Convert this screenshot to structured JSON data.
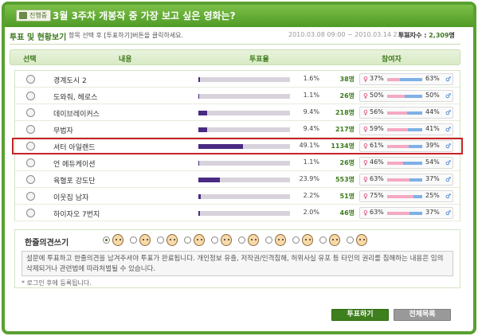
{
  "header": {
    "badge": "진행중",
    "title": "3월 3주차 개봉작 중 가장 보고 싶은 영화는?"
  },
  "subbar": {
    "title": "투표 및 현황보기",
    "desc": "항목 선택 후 [투표하기]버튼을 클릭하세요.",
    "period": "2010.03.08 09:00 ~ 2010.03.14 23:59",
    "total_label": "투표자수 :",
    "total_value": "2,309",
    "total_unit": "명"
  },
  "columns": {
    "select": "선택",
    "content": "내용",
    "rate": "투표율",
    "participants": "참여자"
  },
  "rows": [
    {
      "title": "경계도시 2",
      "pct": "1.6%",
      "pct_value": 1.6,
      "count": "38명",
      "female": "37%",
      "male": "63%",
      "female_value": 37
    },
    {
      "title": "도와줘, 헤로스",
      "pct": "1.1%",
      "pct_value": 1.1,
      "count": "26명",
      "female": "50%",
      "male": "50%",
      "female_value": 50
    },
    {
      "title": "데이브레이커스",
      "pct": "9.4%",
      "pct_value": 9.4,
      "count": "218명",
      "female": "56%",
      "male": "44%",
      "female_value": 56
    },
    {
      "title": "무법자",
      "pct": "9.4%",
      "pct_value": 9.4,
      "count": "217명",
      "female": "59%",
      "male": "41%",
      "female_value": 59
    },
    {
      "title": "셔터 아일랜드",
      "pct": "49.1%",
      "pct_value": 49.1,
      "count": "1134명",
      "female": "61%",
      "male": "39%",
      "female_value": 61,
      "highlighted": true
    },
    {
      "title": "언 에듀케이션",
      "pct": "1.1%",
      "pct_value": 1.1,
      "count": "26명",
      "female": "46%",
      "male": "54%",
      "female_value": 46
    },
    {
      "title": "육혈포 강도단",
      "pct": "23.9%",
      "pct_value": 23.9,
      "count": "553명",
      "female": "63%",
      "male": "37%",
      "female_value": 63
    },
    {
      "title": "이웃집 남자",
      "pct": "2.2%",
      "pct_value": 2.2,
      "count": "51명",
      "female": "75%",
      "male": "25%",
      "female_value": 75
    },
    {
      "title": "하이자오 7번지",
      "pct": "2.0%",
      "pct_value": 2.0,
      "count": "46명",
      "female": "63%",
      "male": "37%",
      "female_value": 63
    }
  ],
  "comment": {
    "label": "한줄의견쓰기",
    "avatar_count": 10,
    "selected_avatar": 0,
    "notice": "설문에 투표하고 한줄의견을 남겨주셔야 투표가 완료됩니다. 개인정보 유출, 저작권/인격침해, 허위사실 유포 등 타인의 권리를 침해하는 내용은 임의 삭제되거나 관련법에 따라처벌될 수 있습니다.",
    "login_note": "* 로그인 후에 등록됩니다."
  },
  "buttons": {
    "vote": "투표하기",
    "list": "전체목록"
  },
  "colors": {
    "brand": "#5aa032",
    "bar": "#4a2a82",
    "female": "#d8346a",
    "male": "#2a72c8",
    "highlight": "#c8222a"
  }
}
